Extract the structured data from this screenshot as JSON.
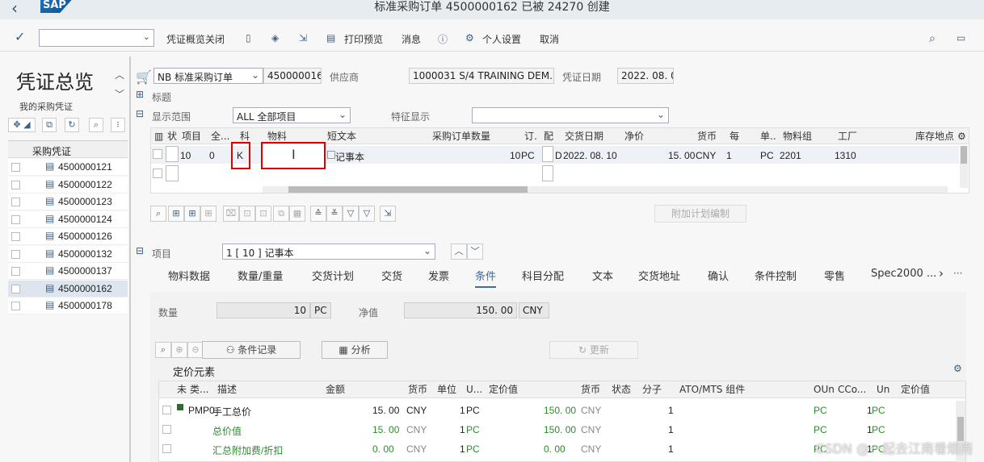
{
  "title_bar": {
    "title": "标准采购订单 4500000162 已被 24270 创建",
    "logo": "SAP"
  },
  "toolbar": {
    "items": [
      "凭证概览关闭",
      "打印预览",
      "消息",
      "个人设置",
      "取消"
    ],
    "command_field": ""
  },
  "left_panel": {
    "title": "凭证总览",
    "subtitle": "我的采购凭证",
    "column_header": "采购凭证",
    "docs": [
      "4500000121",
      "4500000122",
      "4500000123",
      "4500000124",
      "4500000126",
      "4500000132",
      "4500000137",
      "4500000162",
      "4500000178"
    ],
    "selected": "4500000162"
  },
  "header": {
    "doc_type": "NB 标准采购订单",
    "po_number": "4500000162",
    "vendor_label": "供应商",
    "vendor_value": "1000031 S/4 TRAINING DEM...",
    "date_label": "凭证日期",
    "date_value": "2022. 08. 05",
    "title_label": "标题",
    "display_range_label": "显示范围",
    "display_range_value": "ALL 全部项目",
    "feature_label": "特征显示",
    "feature_value": ""
  },
  "items_grid": {
    "headers": [
      "状",
      "项目",
      "全...",
      "科",
      "物料",
      "短文本",
      "采购订单数量",
      "订.",
      "配",
      "交货日期",
      "净价",
      "货币",
      "每",
      "单..",
      "物料组",
      "工厂",
      "库存地点"
    ],
    "row": {
      "item": "10",
      "all": "0",
      "account": "K",
      "material": "",
      "short_text": "记事本",
      "qty": "10",
      "unit": "PC",
      "cat": "D",
      "delivery_date": "2022. 08. 10",
      "net_price": "15. 00",
      "currency": "CNY",
      "per": "1",
      "unit2": "PC",
      "mat_group": "2201",
      "plant": "1310"
    }
  },
  "grid_toolbar": {
    "schedule_button": "附加计划编制"
  },
  "item_detail": {
    "label": "项目",
    "value": "1 [ 10 ] 记事本",
    "tabs": [
      "物料数据",
      "数量/重量",
      "交货计划",
      "交货",
      "发票",
      "条件",
      "科目分配",
      "文本",
      "交货地址",
      "确认",
      "条件控制",
      "零售",
      "Spec2000 ..."
    ],
    "active_tab": "条件",
    "qty_label": "数量",
    "qty_value": "10",
    "qty_unit": "PC",
    "net_label": "净值",
    "net_value": "150. 00",
    "net_currency": "CNY",
    "btn_condition_record": "条件记录",
    "btn_analysis": "分析",
    "btn_update": "更新",
    "pricing_title": "定价元素"
  },
  "pricing_grid": {
    "headers": [
      "未",
      "类...",
      "描述",
      "金额",
      "货币",
      "单位",
      "U...",
      "定价值",
      "货币",
      "状态",
      "分子",
      "ATO/MTS 组件",
      "OUn",
      "CCo...",
      "Un",
      "定价值"
    ],
    "rows": [
      {
        "type": "PMP0",
        "desc": "手工总价",
        "amount": "15. 00",
        "curr": "CNY",
        "unit": "1",
        "u": "PC",
        "value": "150. 00",
        "vcurr": "CNY",
        "num": "1",
        "oun": "PC",
        "cco": "1",
        "un": "PC"
      },
      {
        "type": "",
        "desc": "总价值",
        "amount": "15. 00",
        "curr": "CNY",
        "unit": "1",
        "u": "PC",
        "value": "150. 00",
        "vcurr": "CNY",
        "num": "1",
        "oun": "PC",
        "cco": "1",
        "un": "PC"
      },
      {
        "type": "",
        "desc": "汇总附加费/折扣",
        "amount": "0. 00",
        "curr": "CNY",
        "unit": "1",
        "u": "PC",
        "value": "0. 00",
        "vcurr": "CNY",
        "num": "1",
        "oun": "PC",
        "cco": "1",
        "un": "PC"
      }
    ]
  },
  "watermark": "CSDN @一起去江南看烟雨"
}
